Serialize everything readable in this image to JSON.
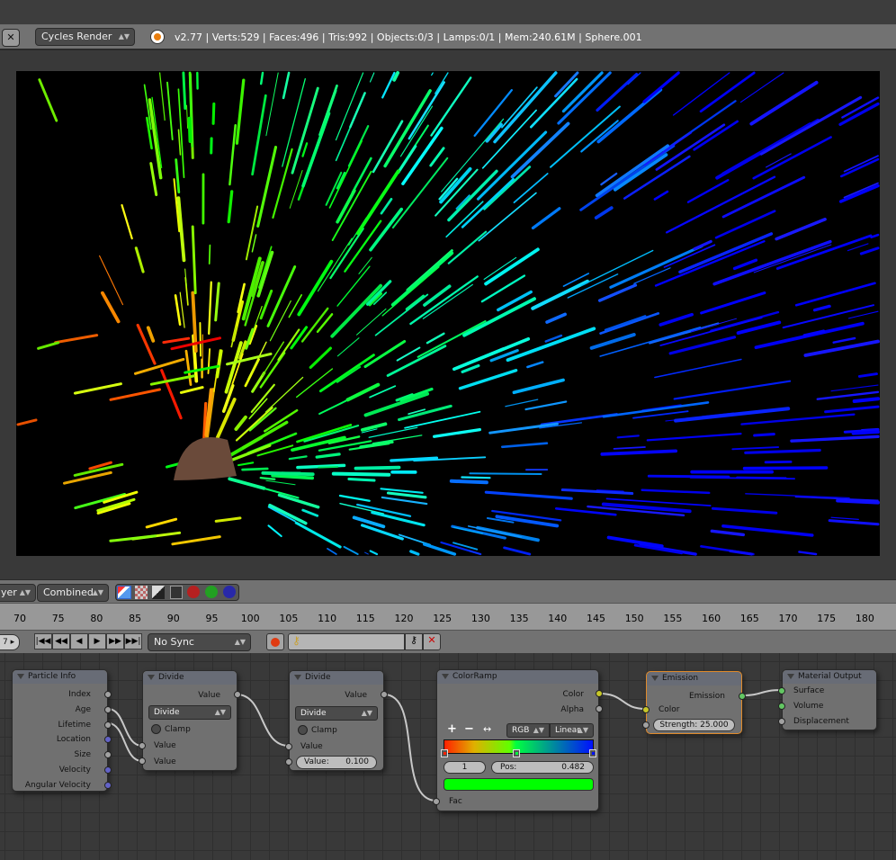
{
  "header": {
    "render_engine": "Cycles Render",
    "stats": "v2.77 | Verts:529 | Faces:496 | Tris:992 | Objects:0/3 | Lamps:0/1 | Mem:240.61M | Sphere.001"
  },
  "image_bar": {
    "layer": "yer",
    "pass": "Combined",
    "icons": [
      "alpha-icon",
      "checker-icon",
      "z-buffer-icon",
      "overlay-icon",
      "red-channel-icon",
      "green-channel-icon",
      "blue-channel-icon"
    ]
  },
  "timeline": {
    "ticks": [
      "70",
      "75",
      "80",
      "85",
      "90",
      "95",
      "100",
      "105",
      "110",
      "115",
      "120",
      "125",
      "130",
      "135",
      "140",
      "145",
      "150",
      "155",
      "160",
      "165",
      "170",
      "175",
      "180"
    ],
    "current_frame": "7",
    "sync": "No Sync"
  },
  "nodes": {
    "particle_info": {
      "title": "Particle Info",
      "outputs": [
        "Index",
        "Age",
        "Lifetime",
        "Location",
        "Size",
        "Velocity",
        "Angular Velocity"
      ]
    },
    "divide1": {
      "title": "Divide",
      "output": "Value",
      "operation": "Divide",
      "clamp": "Clamp",
      "inputs": [
        "Value",
        "Value"
      ]
    },
    "divide2": {
      "title": "Divide",
      "output": "Value",
      "operation": "Divide",
      "clamp": "Clamp",
      "input": "Value",
      "value_label": "Value:",
      "value": "0.100"
    },
    "colorramp": {
      "title": "ColorRamp",
      "outputs": [
        "Color",
        "Alpha"
      ],
      "add": "+",
      "remove": "−",
      "flip": "↔",
      "color_mode": "RGB",
      "interpolation": "Linear",
      "stop_index": "1",
      "pos_label": "Pos:",
      "pos": "0.482",
      "stop_color": "#00ff00",
      "input": "Fac",
      "stops": [
        {
          "pos": 0,
          "color": "#ff2000"
        },
        {
          "pos": 0.482,
          "color": "#00ff40"
        },
        {
          "pos": 1,
          "color": "#0010ff"
        }
      ]
    },
    "emission": {
      "title": "Emission",
      "output": "Emission",
      "input": "Color",
      "strength": "Strength: 25.000",
      "accent": "#e08a2a"
    },
    "material_output": {
      "title": "Material Output",
      "inputs": [
        "Surface",
        "Volume",
        "Displacement"
      ]
    }
  }
}
